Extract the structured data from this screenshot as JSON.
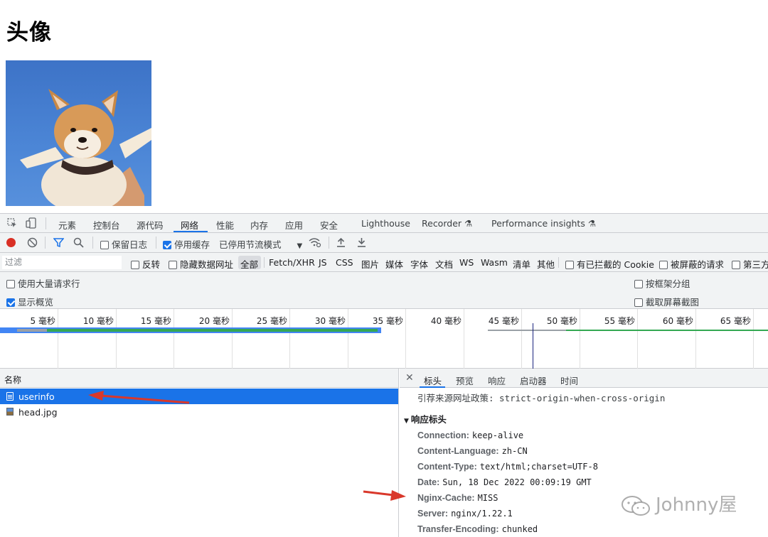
{
  "page": {
    "title": "头像"
  },
  "devtools": {
    "panel_tabs": [
      "元素",
      "控制台",
      "源代码",
      "网络",
      "性能",
      "内存",
      "应用",
      "安全",
      "Lighthouse",
      "Recorder",
      "Performance insights"
    ],
    "active_panel": "网络",
    "toolbar": {
      "preserve_log": "保留日志",
      "disable_cache": "停用缓存",
      "throttling": "已停用节流模式"
    },
    "filter": {
      "placeholder": "过滤",
      "invert": "反转",
      "hide_data_urls": "隐藏数据网址",
      "types": [
        "全部",
        "Fetch/XHR",
        "JS",
        "CSS",
        "图片",
        "媒体",
        "字体",
        "文档",
        "WS",
        "Wasm",
        "清单",
        "其他"
      ],
      "active_type": "全部",
      "blocked_cookies": "有已拦截的 Cookie",
      "blocked_requests": "被屏蔽的请求",
      "third_party": "第三方"
    },
    "options": {
      "large_rows": "使用大量请求行",
      "group_by_frame": "按框架分组",
      "show_overview": "显示概览",
      "capture_screenshots": "截取屏幕截图"
    },
    "timeline_ticks": [
      "5 毫秒",
      "10 毫秒",
      "15 毫秒",
      "20 毫秒",
      "25 毫秒",
      "30 毫秒",
      "35 毫秒",
      "40 毫秒",
      "45 毫秒",
      "50 毫秒",
      "55 毫秒",
      "60 毫秒",
      "65 毫秒"
    ],
    "requests": {
      "column_name": "名称",
      "rows": [
        {
          "name": "userinfo",
          "selected": true
        },
        {
          "name": "head.jpg",
          "selected": false
        }
      ]
    },
    "detail": {
      "tabs": [
        "标头",
        "预览",
        "响应",
        "启动器",
        "时间"
      ],
      "active_tab": "标头",
      "referrer_policy": "引荐来源网址政策: strict-origin-when-cross-origin",
      "response_headers_title": "响应标头",
      "headers": [
        {
          "key": "Connection:",
          "value": "keep-alive"
        },
        {
          "key": "Content-Language:",
          "value": "zh-CN"
        },
        {
          "key": "Content-Type:",
          "value": "text/html;charset=UTF-8"
        },
        {
          "key": "Date:",
          "value": "Sun, 18 Dec 2022 00:09:19 GMT"
        },
        {
          "key": "Nginx-Cache:",
          "value": "MISS"
        },
        {
          "key": "Server:",
          "value": "nginx/1.22.1"
        },
        {
          "key": "Transfer-Encoding:",
          "value": "chunked"
        }
      ]
    }
  },
  "watermark": "Johnny屋",
  "colors": {
    "accent": "#1a73e8",
    "record": "#d93025",
    "arrow": "#d9382b"
  }
}
